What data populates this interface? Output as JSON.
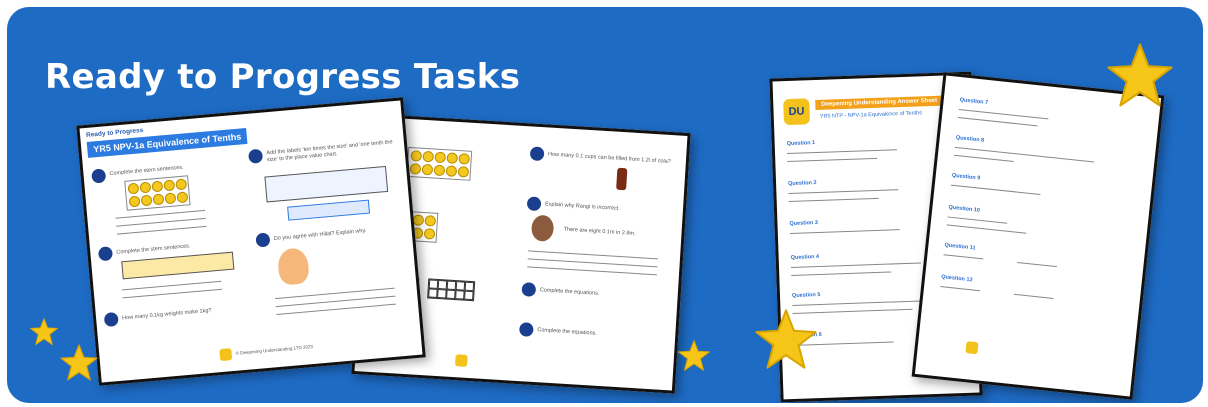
{
  "banner": {
    "title": "Ready to Progress Tasks",
    "background": "#1e6bc4",
    "star_color": "#f5c518"
  },
  "worksheet_1": {
    "kicker": "Ready to Progress",
    "heading": "YR5 NPV-1a Equivalence of Tenths",
    "q1": "Complete the stem sentences.",
    "q2": "Complete the stem sentences.",
    "q3": "How many 0.1kg weights make 1kg?",
    "q4": "Add the labels 'ten times the size' and 'one tenth the size' to the place value chart.",
    "q5": "Do you agree with Hillal? Explain why.",
    "footer": "© Deepening Understanding LTD 2023"
  },
  "worksheet_2": {
    "q1": "How many 0.1 cups can be filled from 1.2l of cola?",
    "q2": "Explain why Rangi is incorrect.",
    "q3": "Complete the equations.",
    "q4": "Complete the equations.",
    "quote": "There are eight 0.1m in 2.8m."
  },
  "answer_sheet": {
    "logo": "DU",
    "title": "Deepening Understanding Answer Sheet",
    "subtitle": "YR5 NTP - NPV-1a Equivalence of Tenths",
    "questions": [
      "Question 1",
      "Question 2",
      "Question 3",
      "Question 4",
      "Question 5",
      "Question 6"
    ]
  },
  "answer_sheet_2": {
    "questions": [
      "Question 7",
      "Question 8",
      "Question 9",
      "Question 10",
      "Question 11",
      "Question 12"
    ]
  }
}
